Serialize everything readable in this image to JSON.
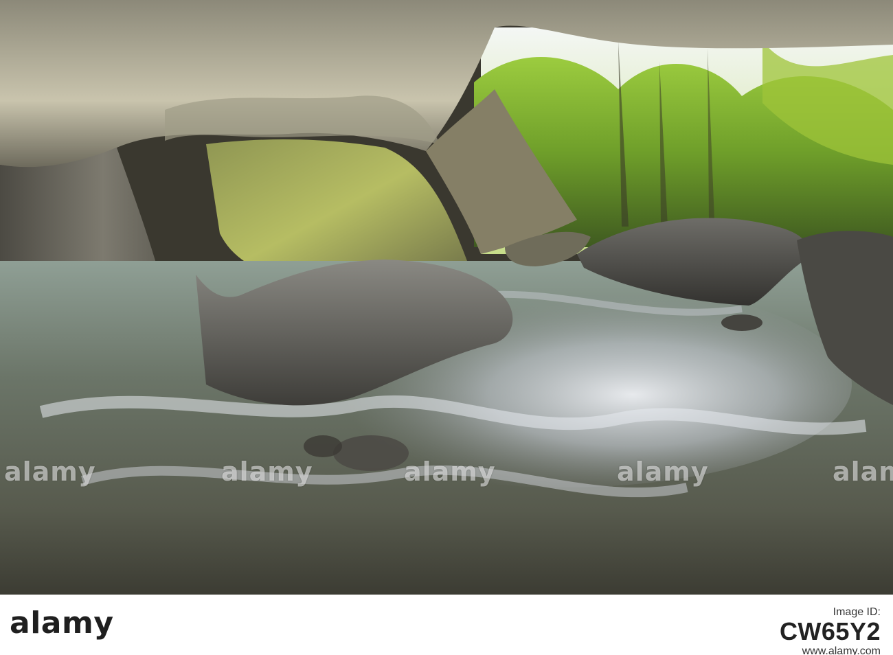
{
  "watermark": {
    "text": "alamy"
  },
  "footer": {
    "logo_text": "alamy",
    "image_id_label": "Image ID:",
    "image_id": "CW65Y2",
    "url": "www.alamy.com"
  },
  "colors": {
    "water_light": "#d9dde2",
    "cave_rock": "#5f5d55",
    "moss": "#a8b13a",
    "forest": "#7fb02c",
    "sky": "#eef2f0",
    "footer_bg": "#ffffff",
    "footer_text": "#1f1f1f"
  }
}
